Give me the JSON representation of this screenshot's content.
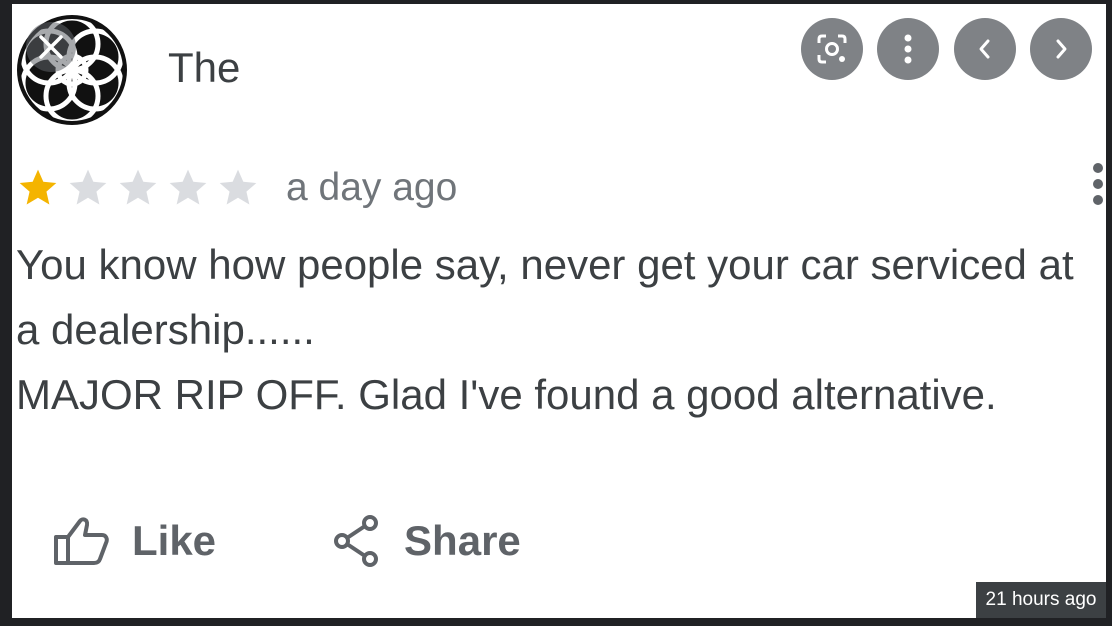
{
  "review": {
    "author": "The",
    "rating": 1,
    "max_rating": 5,
    "time_ago": "a day ago",
    "text": "You know how people say, never get your car serviced at\na dealership......\nMAJOR RIP OFF.  Glad I've found a good alternative.",
    "star_color_filled": "#f4b400",
    "star_color_empty": "#dadce0"
  },
  "actions": {
    "like_label": "Like",
    "share_label": "Share"
  },
  "viewer": {
    "timestamp_badge": "21 hours ago",
    "controls": [
      "lens-icon",
      "more-options-icon",
      "previous-icon",
      "next-icon"
    ],
    "close_icon": "close-icon"
  }
}
